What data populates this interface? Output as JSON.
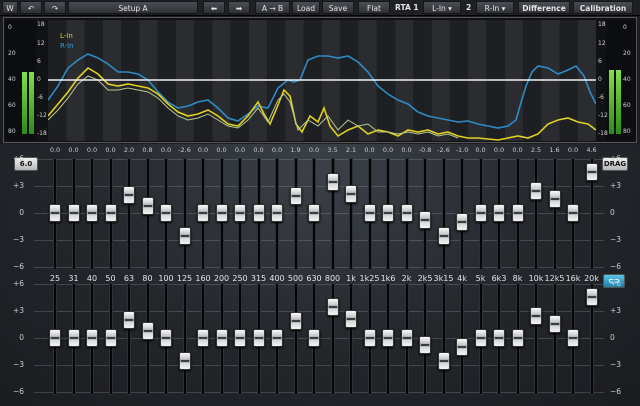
{
  "toolbar": {
    "setup_label": "Setup A",
    "prev_icon": "arrow-left-icon",
    "next_icon": "arrow-right-icon",
    "ab_label": "A → B",
    "load_label": "Load",
    "save_label": "Save",
    "flat_label": "Flat",
    "rta1_label": "RTA 1",
    "rta1_value": "L-In",
    "rta2_label": "2",
    "rta2_value": "R-In",
    "difference_label": "Difference",
    "calibration_label": "Calibration"
  },
  "meters": {
    "left_scale": [
      "0",
      "20",
      "40",
      "60",
      "80"
    ],
    "right_scale": [
      "0",
      "20",
      "40",
      "60",
      "80"
    ]
  },
  "analyzer": {
    "db_left": [
      "18",
      "12",
      "6",
      "0",
      "-6",
      "-12",
      "-18"
    ],
    "db_right": [
      "18",
      "12",
      "6",
      "0",
      "-6",
      "-12",
      "-18"
    ],
    "legend": [
      {
        "name": "L-In",
        "color": "#e0d020"
      },
      {
        "name": "R-In",
        "color": "#3a9ad8"
      }
    ]
  },
  "eq": {
    "gain_values": [
      "0.0",
      "0.0",
      "0.0",
      "0.0",
      "2.0",
      "0.8",
      "0.0",
      "-2.6",
      "0.0",
      "0.0",
      "0.0",
      "0.0",
      "0.0",
      "1.9",
      "0.0",
      "3.5",
      "2.1",
      "0.0",
      "0.0",
      "0.0",
      "-0.8",
      "-2.6",
      "-1.0",
      "0.0",
      "0.0",
      "0.0",
      "2.5",
      "1.6",
      "0.0",
      "4.6"
    ],
    "freq_labels": [
      "25",
      "31",
      "40",
      "50",
      "63",
      "80",
      "100",
      "125",
      "160",
      "200",
      "250",
      "315",
      "400",
      "500",
      "630",
      "800",
      "1k",
      "1k25",
      "1k6",
      "2k",
      "2k5",
      "3k15",
      "4k",
      "5k",
      "6k3",
      "8k",
      "10k",
      "12k5",
      "16k",
      "20k"
    ],
    "scale_top": [
      "+6",
      "+3",
      "0",
      "−3",
      "−6"
    ],
    "scale_bottom": [
      "+6",
      "+3",
      "0",
      "−3",
      "−6"
    ],
    "range_label": "6.0",
    "drag_label": "DRAG",
    "link_icon": "link-icon"
  }
}
